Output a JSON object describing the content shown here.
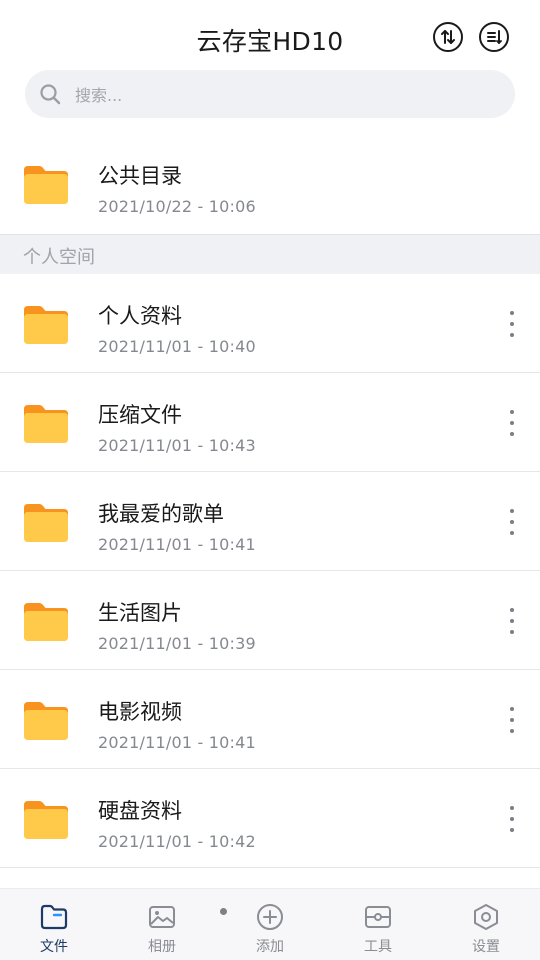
{
  "header": {
    "title": "云存宝HD10",
    "transfer_icon": "transfer-arrows-icon",
    "sort_icon": "sort-icon"
  },
  "search": {
    "placeholder": "搜索..."
  },
  "public_folder": {
    "name": "公共目录",
    "date": "2021/10/22 - 10:06"
  },
  "section": {
    "label": "个人空间"
  },
  "folders": [
    {
      "name": "个人资料",
      "date": "2021/11/01 - 10:40"
    },
    {
      "name": "压缩文件",
      "date": "2021/11/01 - 10:43"
    },
    {
      "name": "我最爱的歌单",
      "date": "2021/11/01 - 10:41"
    },
    {
      "name": "生活图片",
      "date": "2021/11/01 - 10:39"
    },
    {
      "name": "电影视频",
      "date": "2021/11/01 - 10:41"
    },
    {
      "name": "硬盘资料",
      "date": "2021/11/01 - 10:42"
    }
  ],
  "nav": {
    "items": [
      {
        "label": "文件",
        "icon": "folder-icon",
        "active": true
      },
      {
        "label": "相册",
        "icon": "photo-icon",
        "active": false
      },
      {
        "label": "添加",
        "icon": "add-circle-icon",
        "active": false
      },
      {
        "label": "工具",
        "icon": "toolbox-icon",
        "active": false
      },
      {
        "label": "设置",
        "icon": "settings-hexagon-icon",
        "active": false
      }
    ]
  },
  "colors": {
    "folder_body": "#ffc94a",
    "folder_tab": "#f7931e",
    "active_nav": "#1d3b66",
    "inactive_nav": "#8a8d94",
    "section_bg": "#f0f1f4"
  }
}
